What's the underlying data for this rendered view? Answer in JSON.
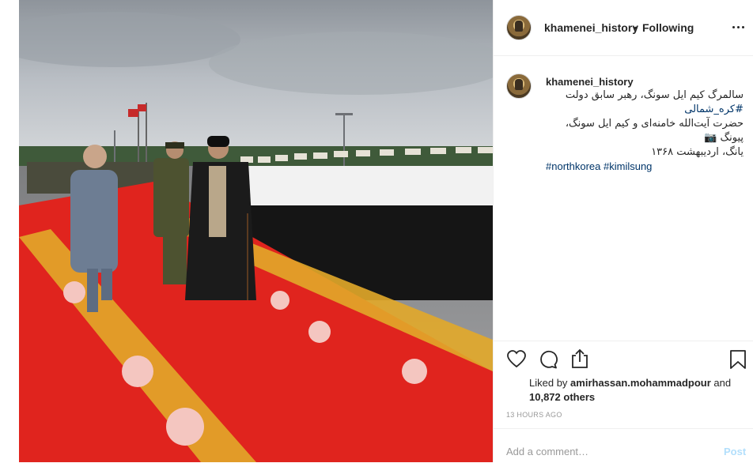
{
  "post": {
    "header": {
      "username": "khamenei_history",
      "separator": "•",
      "follow_status": "Following"
    },
    "caption": {
      "username": "khamenei_history",
      "line1": "سالمرگ کیم ایل سونگ، رهبر سابق دولت",
      "tag_line": "#کره_شمالی",
      "line3": "حضرت آیت‌الله خامنه‌ای و کیم ایل سونگ، پیونگ 📷",
      "line4": "یانگ، اردیبهشت ۱۳۶۸",
      "hashtags": "#northkorea #kimilsung"
    },
    "likes": {
      "prefix": "Liked by ",
      "user": "amirhassan.mohammadpour",
      "connector": " and",
      "count": "10,872 others"
    },
    "timestamp": "13 HOURS AGO",
    "comment_box": {
      "placeholder": "Add a comment…",
      "post_label": "Post"
    }
  },
  "icons": [
    "heart-icon",
    "comment-bubble-icon",
    "share-icon",
    "bookmark-icon",
    "more-options-icon"
  ],
  "colors": {
    "link": "#003569",
    "muted": "#999999",
    "post_disabled": "#b2dffc",
    "carpet_red": "#e0241e"
  }
}
